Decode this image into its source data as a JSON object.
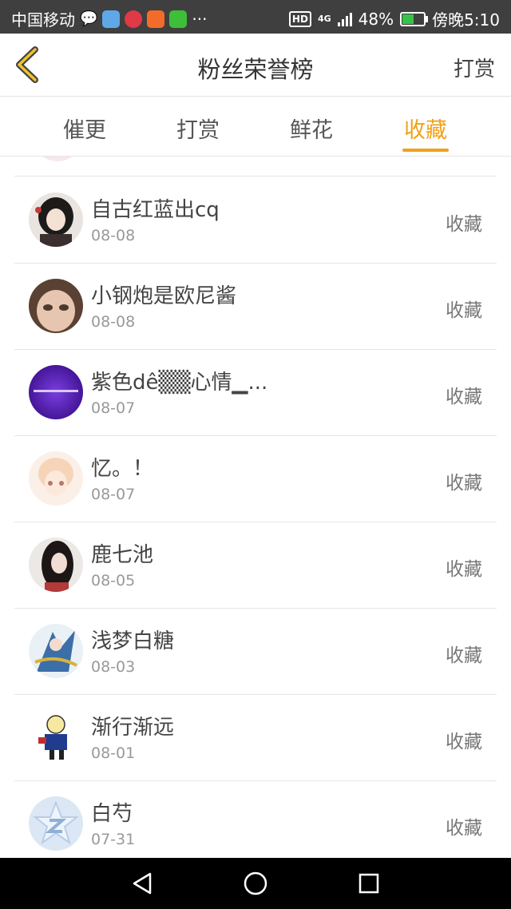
{
  "status_bar": {
    "carrier": "中国移动",
    "network": "4G",
    "hd": "HD",
    "battery": "48%",
    "time": "傍晚5:10",
    "overflow": "···"
  },
  "header": {
    "title": "粉丝荣誉榜",
    "right_action": "打赏"
  },
  "tabs": [
    {
      "label": "催更",
      "active": false
    },
    {
      "label": "打赏",
      "active": false
    },
    {
      "label": "鲜花",
      "active": false
    },
    {
      "label": "收藏",
      "active": true
    }
  ],
  "accent_color": "#f0a11a",
  "list": [
    {
      "name": "自古红蓝出cq",
      "date": "08-08",
      "action": "收藏"
    },
    {
      "name": "小钢炮是欧尼酱",
      "date": "08-08",
      "action": "收藏"
    },
    {
      "name": "紫色dê▒▒心情▁...",
      "date": "08-07",
      "action": "收藏"
    },
    {
      "name": "忆。！",
      "date": "08-07",
      "action": "收藏"
    },
    {
      "name": "鹿七池",
      "date": "08-05",
      "action": "收藏"
    },
    {
      "name": "浅梦白糖",
      "date": "08-03",
      "action": "收藏"
    },
    {
      "name": "渐行渐远",
      "date": "08-01",
      "action": "收藏"
    },
    {
      "name": "白芍",
      "date": "07-31",
      "action": "收藏"
    }
  ]
}
